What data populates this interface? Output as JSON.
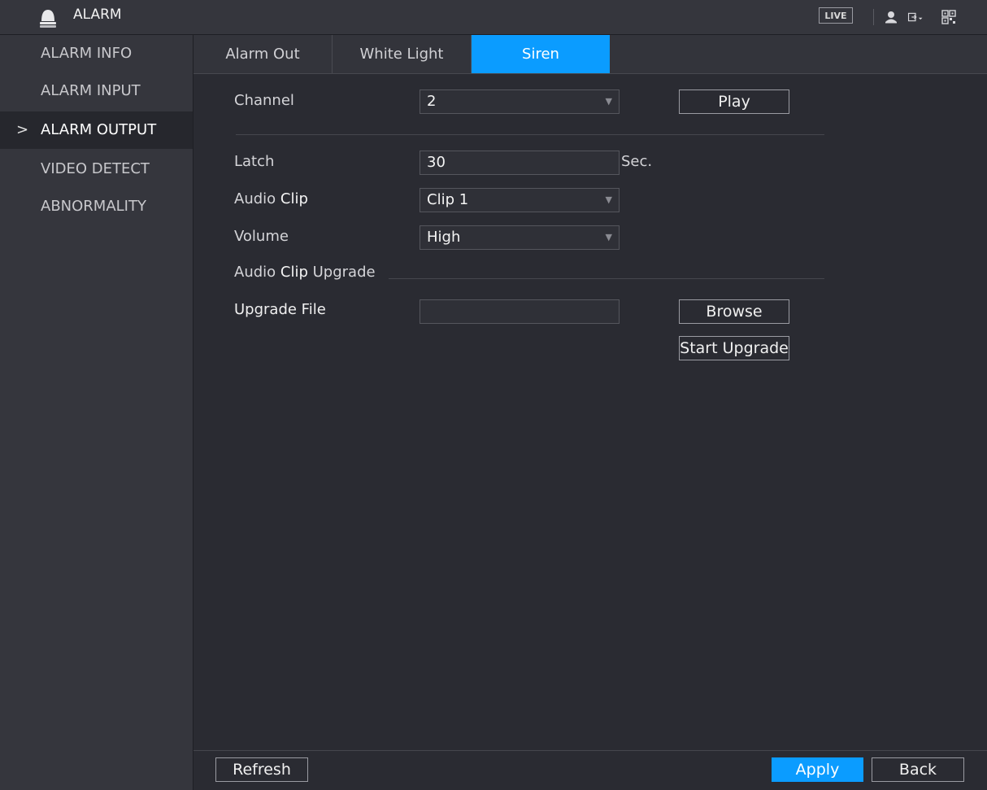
{
  "header": {
    "title": "ALARM",
    "live_label": "LIVE",
    "icons": [
      "bell-icon",
      "user-icon",
      "logout-icon",
      "qr-icon"
    ]
  },
  "sidebar": {
    "items": [
      {
        "label": "ALARM INFO",
        "active": false
      },
      {
        "label": "ALARM INPUT",
        "active": false
      },
      {
        "label": "ALARM OUTPUT",
        "active": true
      },
      {
        "label": "VIDEO DETECT",
        "active": false
      },
      {
        "label": "ABNORMALITY",
        "active": false
      }
    ],
    "active_marker": ">"
  },
  "tabs": [
    {
      "label": "Alarm Out",
      "active": false
    },
    {
      "label": "White Light",
      "active": false
    },
    {
      "label": "Siren",
      "active": true
    }
  ],
  "form": {
    "channel": {
      "label": "Channel",
      "value": "2"
    },
    "play_label": "Play",
    "latch": {
      "label": "Latch",
      "value": "30",
      "unit": "Sec."
    },
    "audio_clip": {
      "label_prefix": "Audio ",
      "label_bold": "Clip",
      "value": "Clip 1"
    },
    "volume": {
      "label": "Volume",
      "value": "High"
    },
    "upgrade_section": {
      "label_prefix": "Audio ",
      "label_bold": "Clip",
      "label_suffix": " Upgrade"
    },
    "upgrade_file": {
      "label": "Upgrade File",
      "value": ""
    },
    "browse_label": "Browse",
    "start_upgrade_label": "Start Upgrade",
    "dropdown_arrow": "▼"
  },
  "footer": {
    "refresh_label": "Refresh",
    "apply_label": "Apply",
    "back_label": "Back"
  },
  "colors": {
    "accent": "#0b9cff",
    "background": "#2a2b32",
    "panel": "#35363d"
  }
}
